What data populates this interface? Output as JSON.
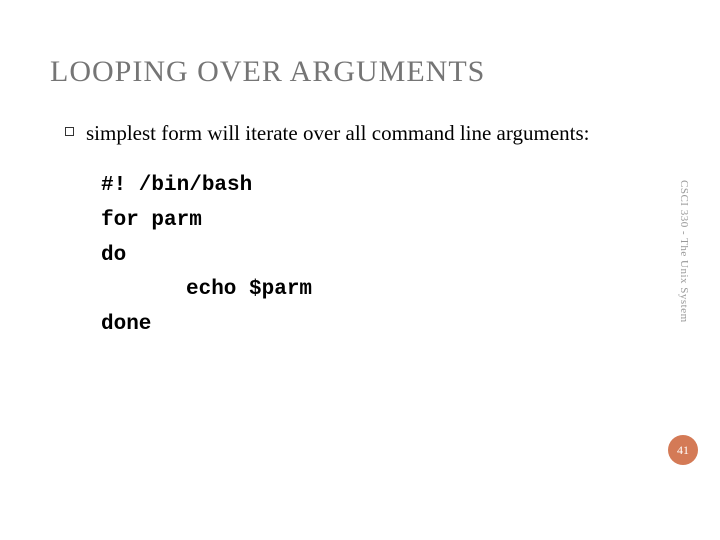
{
  "title": "LOOPING OVER ARGUMENTS",
  "bullet": "simplest form will iterate over all command line arguments:",
  "code": {
    "line1": "#! /bin/bash",
    "line2": "for parm",
    "line3": "do",
    "line4": "echo $parm",
    "line5": "done"
  },
  "sideText": "CSCI 330 - The Unix System",
  "pageNumber": "41"
}
